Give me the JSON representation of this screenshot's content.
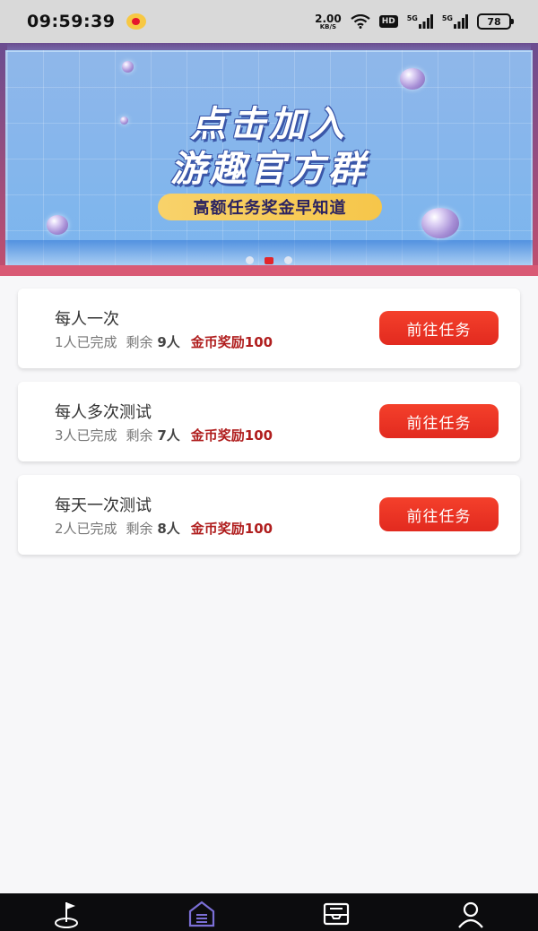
{
  "status_bar": {
    "time": "09:59:39",
    "net_speed_value": "2.00",
    "net_speed_unit": "KB/S",
    "hd_label": "HD",
    "signal_1_label": "5G",
    "signal_2_label": "5G",
    "battery": "78"
  },
  "banner": {
    "title_line1": "点击加入",
    "title_line2": "游趣官方群",
    "subtitle": "高额任务奖金早知道",
    "page_indicator": {
      "count": 3,
      "active_index": 1
    }
  },
  "tasks": [
    {
      "title": "每人一次",
      "completed": "1人已完成",
      "remaining_label": "剩余",
      "remaining_count": "9人",
      "reward": "金币奖励100",
      "button_label": "前往任务"
    },
    {
      "title": "每人多次测试",
      "completed": "3人已完成",
      "remaining_label": "剩余",
      "remaining_count": "7人",
      "reward": "金币奖励100",
      "button_label": "前往任务"
    },
    {
      "title": "每天一次测试",
      "completed": "2人已完成",
      "remaining_label": "剩余",
      "remaining_count": "8人",
      "reward": "金币奖励100",
      "button_label": "前往任务"
    }
  ],
  "bottom_nav": {
    "items": [
      {
        "icon": "flag-icon",
        "active": false
      },
      {
        "icon": "home-icon",
        "active": true
      },
      {
        "icon": "inbox-icon",
        "active": false
      },
      {
        "icon": "user-icon",
        "active": false
      }
    ],
    "active_color": "#7b6fd6"
  },
  "colors": {
    "button_red": "#e8321f",
    "reward_red": "#b01e1e",
    "banner_gold": "#f7c94d"
  }
}
